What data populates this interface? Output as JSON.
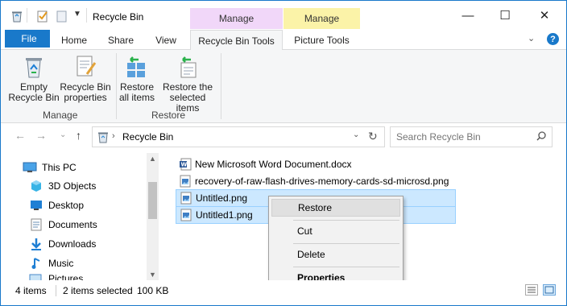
{
  "window": {
    "title": "Recycle Bin",
    "context_tabs": [
      {
        "label": "Manage",
        "color": "#f1d7f9"
      },
      {
        "label": "Manage",
        "color": "#fbf3a8"
      }
    ],
    "controls": {
      "minimize": "—",
      "maximize": "☐",
      "close": "✕"
    }
  },
  "ribbon": {
    "tabs": [
      {
        "label": "File"
      },
      {
        "label": "Home"
      },
      {
        "label": "Share"
      },
      {
        "label": "View"
      },
      {
        "label": "Recycle Bin Tools"
      },
      {
        "label": "Picture Tools"
      }
    ],
    "groups": [
      {
        "label": "Manage",
        "buttons": [
          {
            "label_line1": "Empty",
            "label_line2": "Recycle Bin",
            "icon": "recycle-bin-icon"
          },
          {
            "label_line1": "Recycle Bin",
            "label_line2": "properties",
            "icon": "properties-icon"
          }
        ]
      },
      {
        "label": "Restore",
        "buttons": [
          {
            "label_line1": "Restore",
            "label_line2": "all items",
            "icon": "restore-all-icon"
          },
          {
            "label_line1": "Restore the",
            "label_line2": "selected items",
            "icon": "restore-selected-icon"
          }
        ]
      }
    ]
  },
  "address": {
    "path": "Recycle Bin",
    "search_placeholder": "Search Recycle Bin"
  },
  "nav_pane": {
    "items": [
      {
        "label": "This PC",
        "icon": "this-pc-icon"
      },
      {
        "label": "3D Objects",
        "icon": "3d-objects-icon"
      },
      {
        "label": "Desktop",
        "icon": "desktop-icon"
      },
      {
        "label": "Documents",
        "icon": "documents-icon"
      },
      {
        "label": "Downloads",
        "icon": "downloads-icon"
      },
      {
        "label": "Music",
        "icon": "music-icon"
      },
      {
        "label": "Pictures",
        "icon": "pictures-icon"
      }
    ]
  },
  "files": [
    {
      "name": "New Microsoft Word Document.docx",
      "icon": "word-doc-icon",
      "selected": false
    },
    {
      "name": "recovery-of-raw-flash-drives-memory-cards-sd-microsd.png",
      "icon": "image-icon",
      "selected": false
    },
    {
      "name": "Untitled.png",
      "icon": "image-icon",
      "selected": true
    },
    {
      "name": "Untitled1.png",
      "icon": "image-icon",
      "selected": true
    }
  ],
  "context_menu": {
    "items": [
      {
        "label": "Restore"
      },
      {
        "label": "Cut"
      },
      {
        "label": "Delete"
      },
      {
        "label": "Properties"
      }
    ]
  },
  "status": {
    "item_count": "4 items",
    "selection": "2 items selected",
    "size": "100 KB"
  },
  "colors": {
    "accent": "#1979ca",
    "selection": "#cce8ff"
  }
}
